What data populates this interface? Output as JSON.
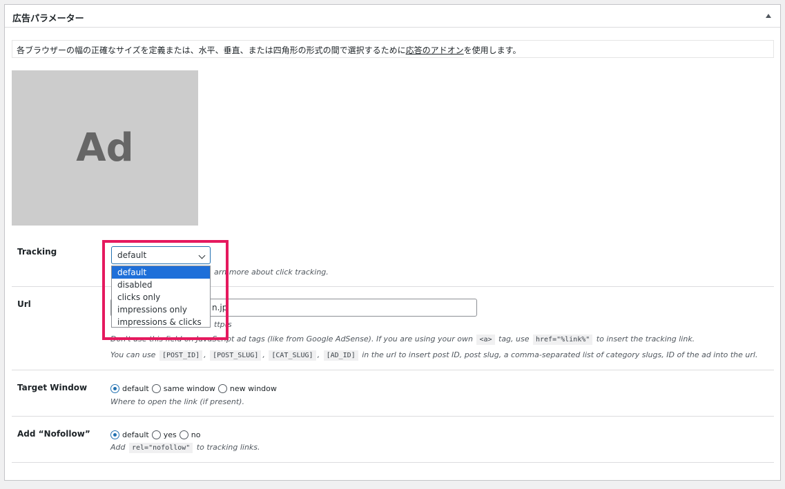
{
  "postbox": {
    "title": "広告パラメーター"
  },
  "notice": {
    "text_before": "各ブラウザーの幅の正確なサイズを定義または、水平、垂直、または四角形の形式の間で選択するために",
    "link": "応答のアドオン",
    "text_after": "を使用します。"
  },
  "ad_placeholder": {
    "text": "Ad"
  },
  "tracking": {
    "label": "Tracking",
    "selected": "default",
    "options": [
      "default",
      "disabled",
      "clicks only",
      "impressions only",
      "impressions & clicks"
    ],
    "help_partial": "arn more about click tracking."
  },
  "url": {
    "label": "Url",
    "value_visible": "n.jp",
    "hint_partial": "ttp(s",
    "desc1_partial": "Don't use this field on JavaScript ad tags (like from Google AdSense). If you are using your own",
    "desc1_code1": "<a>",
    "desc1_mid": "tag, use",
    "desc1_code2": "href=\"%link%\"",
    "desc1_end": "to insert the tracking link.",
    "desc2_start": "You can use",
    "codes": [
      "[POST_ID]",
      "[POST_SLUG]",
      "[CAT_SLUG]",
      "[AD_ID]"
    ],
    "desc2_end": "in the url to insert post ID, post slug, a comma-separated list of category slugs, ID of the ad into the url."
  },
  "target_window": {
    "label": "Target Window",
    "options": [
      "default",
      "same window",
      "new window"
    ],
    "selected": "default",
    "help": "Where to open the link (if present)."
  },
  "nofollow": {
    "label": "Add “Nofollow”",
    "options": [
      "default",
      "yes",
      "no"
    ],
    "selected": "default",
    "help_start": "Add",
    "help_code": "rel=\"nofollow\"",
    "help_end": "to tracking links."
  },
  "colors": {
    "highlight": "#e5195e",
    "accent": "#2271b1",
    "selected_option": "#1e6fd9"
  }
}
